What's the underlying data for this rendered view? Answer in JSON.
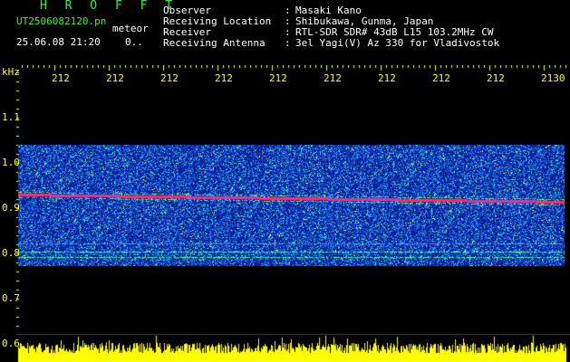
{
  "app": {
    "logo": "H R O F F T",
    "filename": "UT2506082120.pn",
    "mode": "meteor",
    "datetime": "25.06.08 21:20",
    "counter": "0.."
  },
  "header": {
    "labels": [
      "Observer",
      "Receiving Location",
      "Receiver",
      "Receiving Antenna"
    ],
    "colons": [
      ":",
      ":",
      ":",
      ":"
    ],
    "values": [
      "Masaki Kano",
      "Shibukawa, Gunma, Japan",
      "RTL-SDR SDR# 43dB L15 103.2MHz CW",
      "3el Yagi(V) Az 330 for Vladivostok"
    ]
  },
  "axis": {
    "unit": "kHz",
    "y_ticks": [
      "1.1",
      "1.0",
      "0.9",
      "0.8",
      "0.7",
      "0.6"
    ],
    "x_ticks": [
      "212",
      "212",
      "212",
      "212",
      "212",
      "212",
      "212",
      "212",
      "212",
      "2130"
    ]
  },
  "colors": {
    "background": "#000000",
    "noise_low": "#0a22aa",
    "noise_mid": "#2aa8ff",
    "signal": "#ff2a7a",
    "power": "#ffff00",
    "text_green": "#3cf03c"
  }
}
